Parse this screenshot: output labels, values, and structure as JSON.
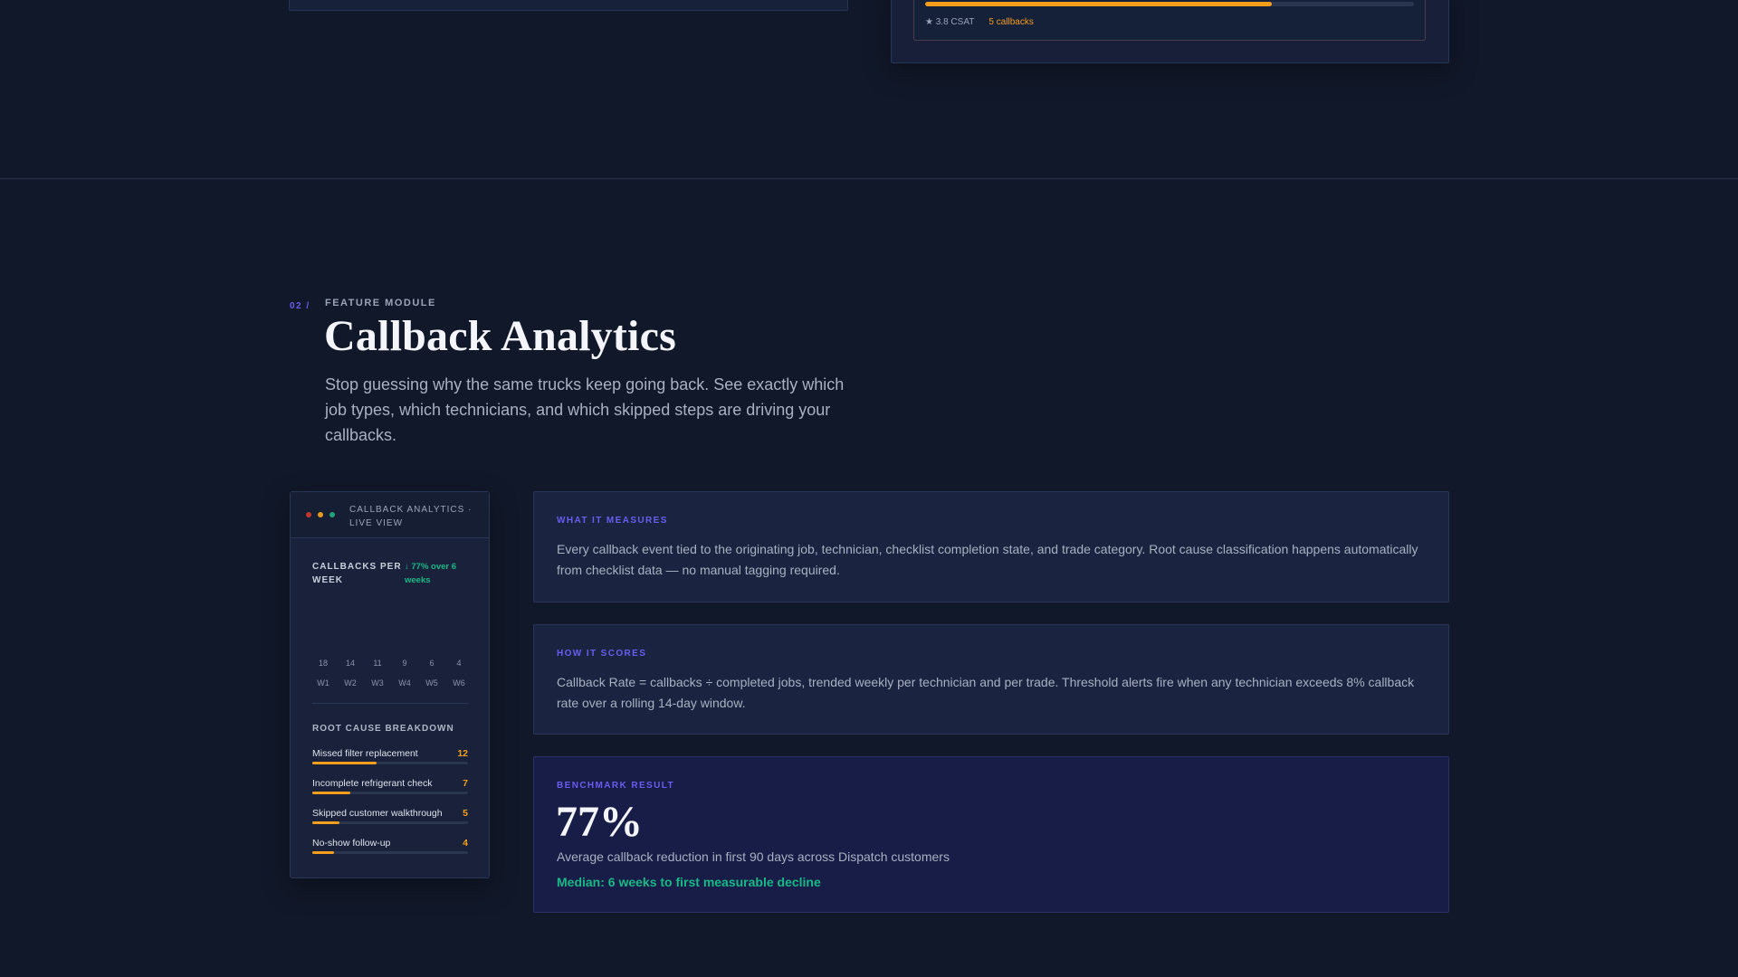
{
  "previous_section": {
    "progress_fraction": 0.71,
    "csat": "★ 3.8 CSAT",
    "callbacks": "5 callbacks"
  },
  "section": {
    "number": "02 /",
    "eyebrow": "FEATURE MODULE",
    "title": "Callback Analytics",
    "subtitle": "Stop guessing why the same trucks keep going back. See exactly which job types, which technicians, and which skipped steps are driving your callbacks."
  },
  "app_panel": {
    "title": "CALLBACK ANALYTICS · LIVE VIEW",
    "chart_label": "CALLBACKS PER WEEK",
    "trend": "↓ 77% over 6 weeks",
    "root_cause_label": "ROOT CAUSE BREAKDOWN",
    "root_causes": [
      {
        "name": "Missed filter replacement",
        "count": "12",
        "value": 12
      },
      {
        "name": "Incomplete refrigerant check",
        "count": "7",
        "value": 7
      },
      {
        "name": "Skipped customer walkthrough",
        "count": "5",
        "value": 5
      },
      {
        "name": "No-show follow-up",
        "count": "4",
        "value": 4
      }
    ],
    "root_cause_max": 29
  },
  "chart_data": {
    "type": "bar",
    "categories": [
      "W1",
      "W2",
      "W3",
      "W4",
      "W5",
      "W6"
    ],
    "values": [
      18,
      14,
      11,
      9,
      6,
      4
    ],
    "title": "CALLBACKS PER WEEK",
    "xlabel": "",
    "ylabel": "",
    "grid": false
  },
  "cards": {
    "measures": {
      "label": "WHAT IT MEASURES",
      "body": "Every callback event tied to the originating job, technician, checklist completion state, and trade category. Root cause classification happens automatically from checklist data — no manual tagging required."
    },
    "scores": {
      "label": "HOW IT SCORES",
      "body": "Callback Rate = callbacks ÷ completed jobs, trended weekly per technician and per trade. Threshold alerts fire when any technician exceeds 8% callback rate over a rolling 14-day window."
    },
    "benchmark": {
      "label": "BENCHMARK RESULT",
      "stat": "77%",
      "description": "Average callback reduction in first 90 days across Dispatch customers",
      "median": "Median: 6 weeks to first measurable decline"
    }
  },
  "colors": {
    "accent": "#6a5cf0",
    "amber": "#f59e1b",
    "green": "#18b887"
  }
}
